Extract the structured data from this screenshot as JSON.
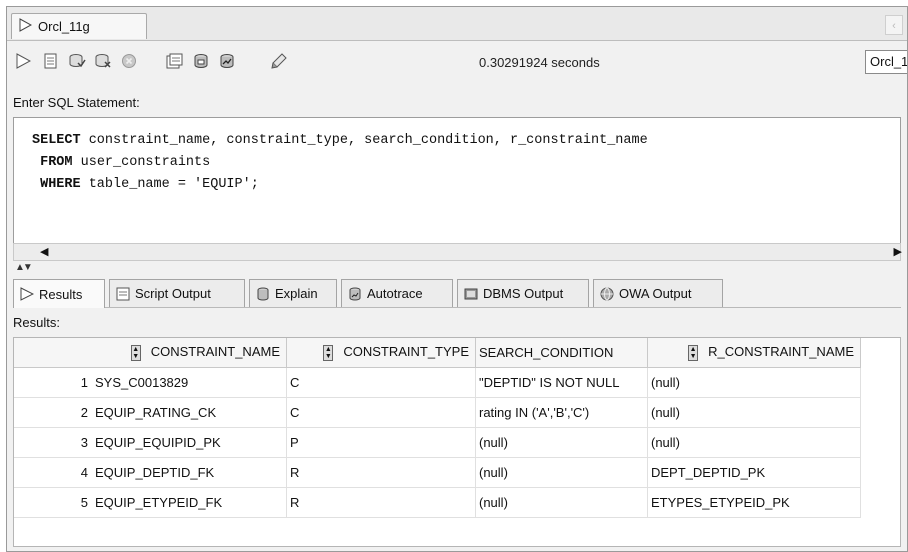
{
  "document_tab": {
    "label": "Orcl_11g"
  },
  "toolbar": {
    "timing": "0.30291924 seconds",
    "connection": "Orcl_1"
  },
  "editor": {
    "label": "Enter SQL Statement:",
    "lines": [
      {
        "kw": "SELECT",
        "rest": " constraint_name, constraint_type, search_condition, r_constraint_name"
      },
      {
        "kw": " FROM",
        "rest": " user_constraints"
      },
      {
        "kw": " WHERE",
        "rest": " table_name = 'EQUIP';"
      }
    ]
  },
  "result_tabs": [
    "Results",
    "Script Output",
    "Explain",
    "Autotrace",
    "DBMS Output",
    "OWA Output"
  ],
  "results": {
    "label": "Results:",
    "columns": [
      "CONSTRAINT_NAME",
      "CONSTRAINT_TYPE",
      "SEARCH_CONDITION",
      "R_CONSTRAINT_NAME"
    ],
    "rows": [
      {
        "n": "1",
        "name": "SYS_C0013829",
        "type": "C",
        "cond": "\"DEPTID\" IS NOT NULL",
        "rname": "(null)"
      },
      {
        "n": "2",
        "name": "EQUIP_RATING_CK",
        "type": "C",
        "cond": "rating IN ('A','B','C')",
        "rname": "(null)"
      },
      {
        "n": "3",
        "name": "EQUIP_EQUIPID_PK",
        "type": "P",
        "cond": "(null)",
        "rname": "(null)"
      },
      {
        "n": "4",
        "name": "EQUIP_DEPTID_FK",
        "type": "R",
        "cond": "(null)",
        "rname": "DEPT_DEPTID_PK"
      },
      {
        "n": "5",
        "name": "EQUIP_ETYPEID_FK",
        "type": "R",
        "cond": "(null)",
        "rname": "ETYPES_ETYPEID_PK"
      }
    ]
  }
}
